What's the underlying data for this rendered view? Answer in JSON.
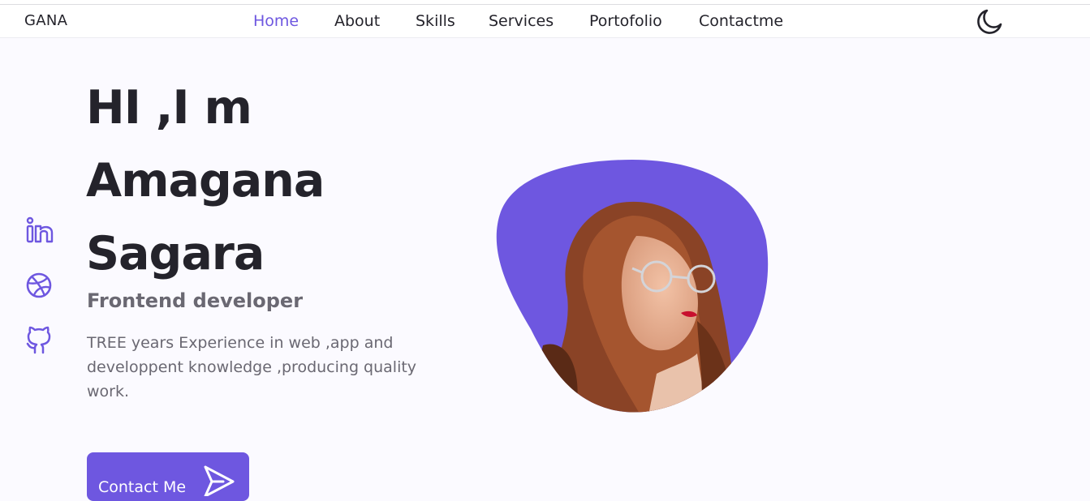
{
  "nav": {
    "logo": "GANA",
    "links": [
      {
        "label": "Home",
        "active": true
      },
      {
        "label": "About",
        "active": false
      },
      {
        "label": "Skills",
        "active": false
      },
      {
        "label": "Services",
        "active": false
      },
      {
        "label": "Portofolio",
        "active": false
      },
      {
        "label": "Contactme",
        "active": false
      }
    ],
    "theme_icon": "moon-icon"
  },
  "socials": [
    {
      "icon": "linkedin-icon"
    },
    {
      "icon": "dribbble-icon"
    },
    {
      "icon": "github-icon"
    }
  ],
  "hero": {
    "title_lines": [
      "HI ,I m",
      "Amagana",
      "Sagara"
    ],
    "subtitle": "Frontend developer",
    "description": "TREE years Experience in web ,app and developpent knowledge ,producing quality work.",
    "button_label": "Contact Me",
    "button_icon": "send-icon",
    "image": "profile-photo"
  },
  "colors": {
    "accent": "#6e57e0",
    "text": "#24232b",
    "muted": "#6a6872",
    "background": "#fbfaff"
  }
}
